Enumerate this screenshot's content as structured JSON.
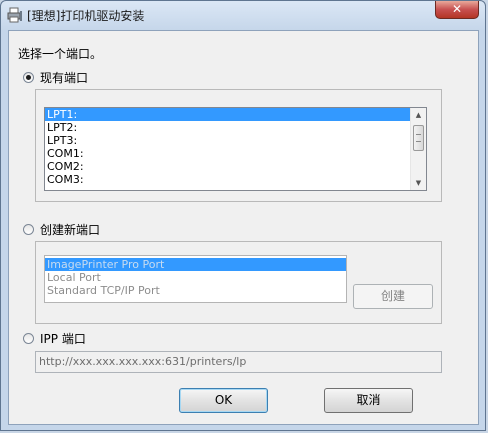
{
  "window": {
    "title": "[理想]打印机驱动安装",
    "close_glyph": "✕"
  },
  "prompt": "选择一个端口。",
  "existing": {
    "label": "现有端口",
    "selected": true,
    "ports": [
      "LPT1:",
      "LPT2:",
      "LPT3:",
      "COM1:",
      "COM2:",
      "COM3:"
    ],
    "selected_index": 0
  },
  "new_port": {
    "label": "创建新端口",
    "selected": false,
    "types": [
      "ImagePrinter Pro Port",
      "Local Port",
      "Standard TCP/IP Port"
    ],
    "selected_index": 0,
    "create_label": "创建"
  },
  "ipp": {
    "label": "IPP 端口",
    "selected": false,
    "url": "http://xxx.xxx.xxx.xxx:631/printers/lp"
  },
  "buttons": {
    "ok": "OK",
    "cancel": "取消"
  }
}
